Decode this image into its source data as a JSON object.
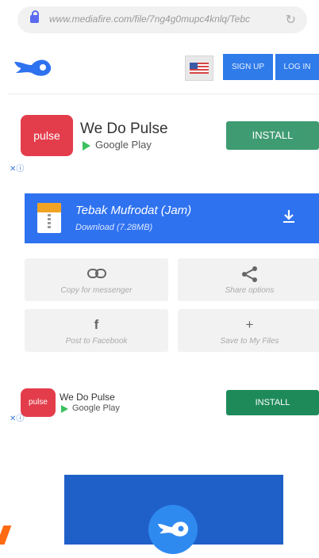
{
  "browser": {
    "url": "www.mediafire.com/file/7ng4g0mupc4knlq/Tebc"
  },
  "header": {
    "sign_up": "SIGN UP",
    "log_in": "LOG IN"
  },
  "ad1": {
    "icon_text": "pulse",
    "title": "We Do Pulse",
    "store": "Google Play",
    "install": "INSTALL",
    "adchoices": "✕ⓘ"
  },
  "download": {
    "file_name": "Tebak Mufrodat (Jam)",
    "size_label": "Download (7.28MB)"
  },
  "share": [
    {
      "label": "Copy for messenger",
      "icon": "⊖"
    },
    {
      "label": "Share options",
      "icon": "⋖"
    },
    {
      "label": "Post to Facebook",
      "icon": "f"
    },
    {
      "label": "Save to My Files",
      "icon": "+"
    }
  ],
  "ad2": {
    "icon_text": "pulse",
    "title": "We Do Pulse",
    "store": "Google Play",
    "install": "INSTALL",
    "adchoices": "✕ⓘ"
  }
}
